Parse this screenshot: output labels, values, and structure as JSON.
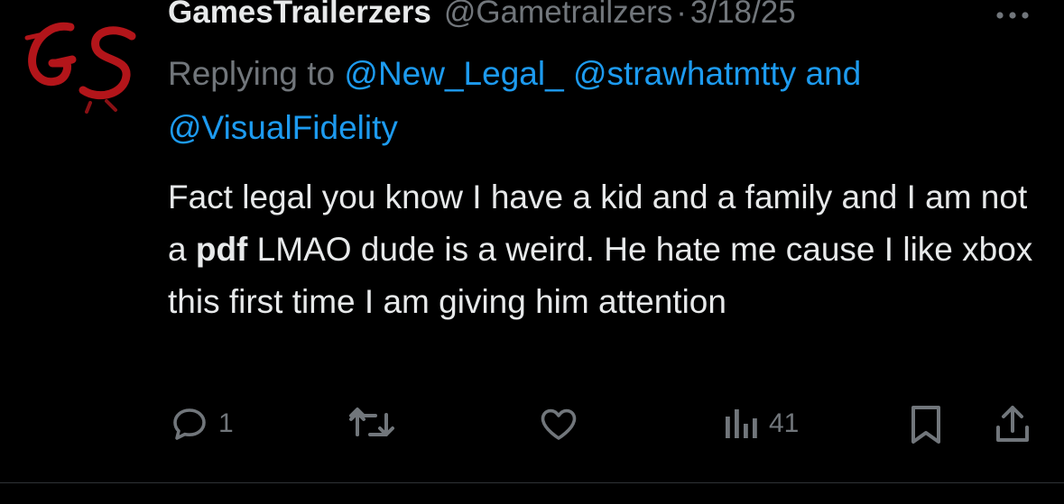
{
  "tweet": {
    "author_name": "GamesTrailerzers",
    "author_handle": "@Gametrailzers",
    "separator": "·",
    "date": "3/18/25",
    "reply_prefix": "Replying to",
    "reply_mention_1": "@New_Legal_",
    "reply_mention_2": "@strawhatmtty",
    "reply_and": "and",
    "reply_mention_3": "@VisualFidelity",
    "text_part_1": "Fact legal you know I have a kid and a family and I am not a ",
    "text_bold": "pdf",
    "text_part_2": " LMAO dude is a weird. He hate me cause I like xbox this first time I am giving him attention"
  },
  "actions": {
    "reply_count": "1",
    "views_count": "41"
  },
  "icons": {
    "reply": "reply-icon",
    "retweet": "retweet-icon",
    "like": "like-icon",
    "views": "views-icon",
    "bookmark": "bookmark-icon",
    "share": "share-icon",
    "more": "more-icon"
  },
  "colors": {
    "background": "#000000",
    "text": "#e7e9ea",
    "secondary": "#71767b",
    "link": "#1d9bf0",
    "avatar_red": "#b3151a"
  }
}
